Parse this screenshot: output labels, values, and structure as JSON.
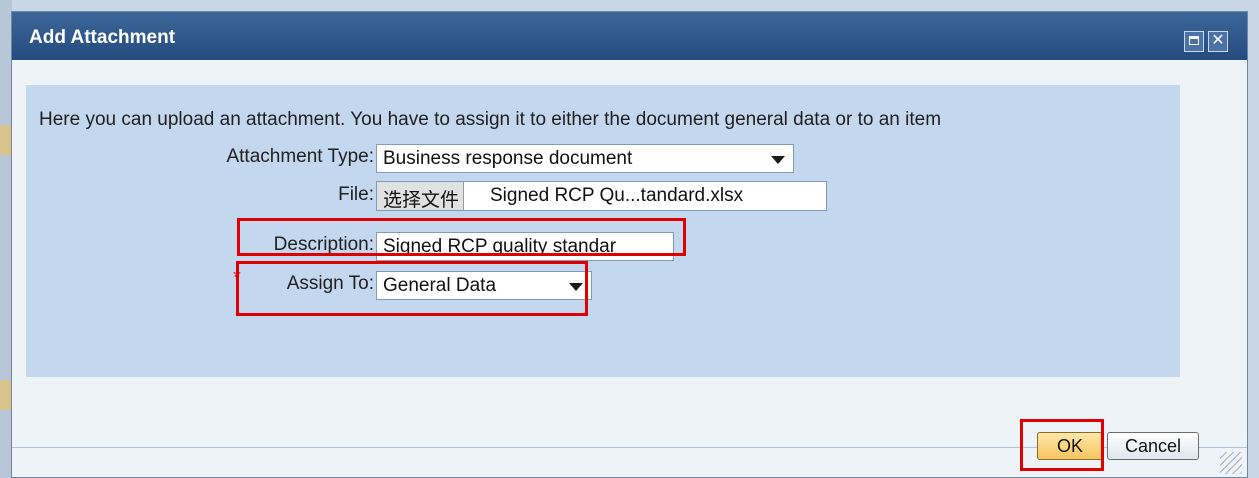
{
  "dialog": {
    "title": "Add Attachment",
    "maximize_icon": "maximize-icon",
    "close_icon": "close-icon",
    "close_glyph": "✕"
  },
  "form": {
    "intro": "Here you can upload an attachment. You have to assign it to either the document general data or to an item",
    "attachment_type": {
      "label": "Attachment Type:",
      "value": "Business response document"
    },
    "file": {
      "label": "File:",
      "button": "选择文件",
      "name": "Signed RCP Qu...tandard.xlsx"
    },
    "description": {
      "label": "Description:",
      "value": "Signed RCP quality standar"
    },
    "assign_to": {
      "label": "Assign To:",
      "required_mark": "*",
      "value": "General Data"
    }
  },
  "footer": {
    "ok_label": "OK",
    "cancel_label": "Cancel"
  },
  "colors": {
    "titlebar": "#2c5688",
    "panel": "#c3d8ee",
    "highlight": "#e00000",
    "ok_button": "#f6c560"
  }
}
